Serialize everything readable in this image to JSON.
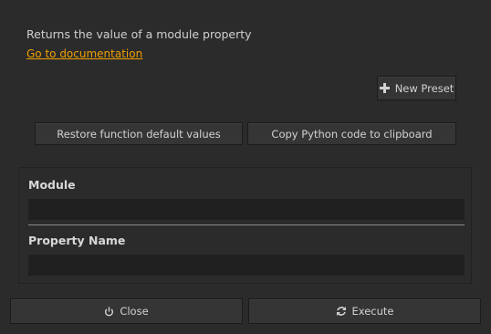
{
  "description": "Returns the value of a module property",
  "doc_link": "Go to documentation",
  "buttons": {
    "new_preset": "New Preset",
    "restore": "Restore function default values",
    "copy_python": "Copy Python code to clipboard",
    "close": "Close",
    "execute": "Execute"
  },
  "params": [
    {
      "label": "Module",
      "value": ""
    },
    {
      "label": "Property Name",
      "value": ""
    }
  ],
  "icons": {
    "new_preset": "plus-icon",
    "close": "power-icon",
    "execute": "refresh-icon"
  },
  "colors": {
    "link": "#f0a000",
    "background": "#2b2b2b"
  }
}
